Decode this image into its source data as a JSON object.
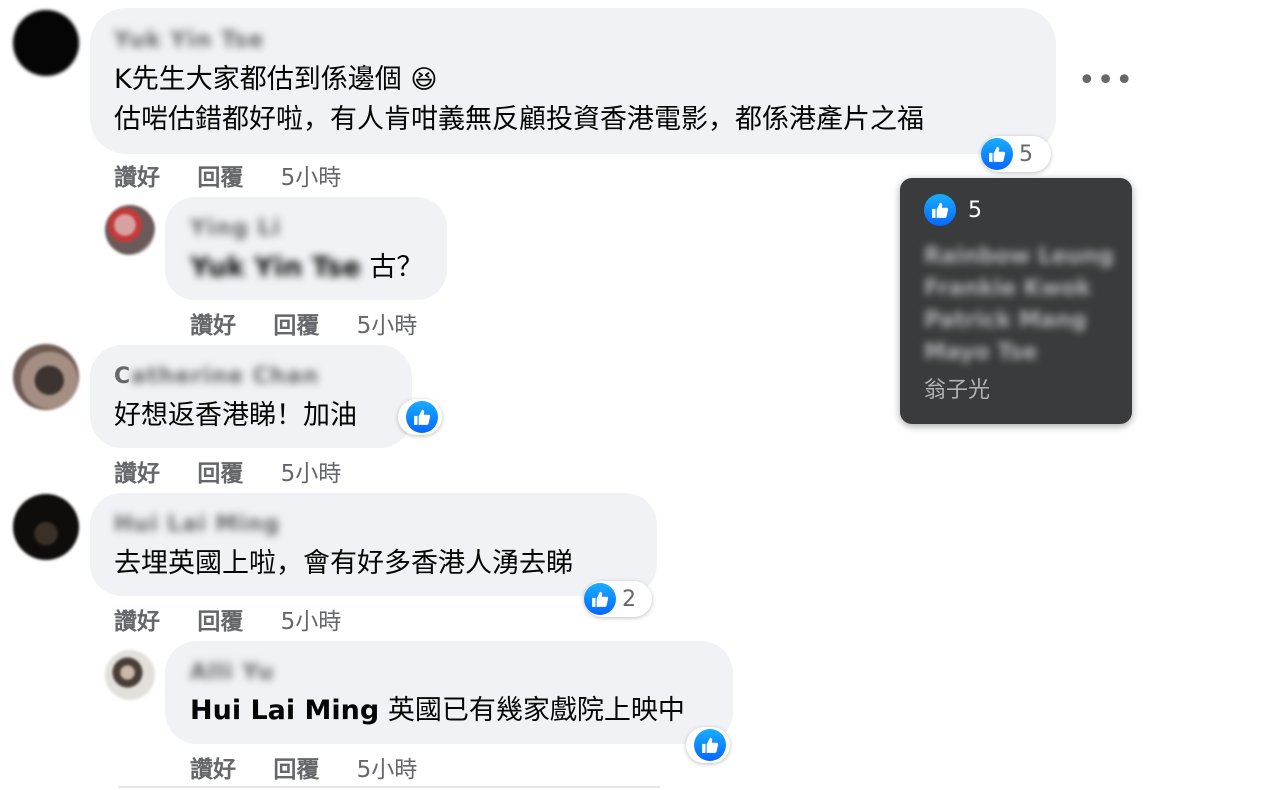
{
  "comments": [
    {
      "author": "Yuk Yin Tse",
      "lines": [
        "K先生大家都估到係邊個",
        "估啱估錯都好啦，有人肯咁義無反顧投資香港電影，都係港產片之福"
      ],
      "emoji": "😆",
      "reaction_count": "5",
      "like_label": "讚好",
      "reply_label": "回覆",
      "time": "5小時"
    },
    {
      "author": "Ying Li",
      "mention": "Yuk Yin Tse",
      "text": " 古？",
      "like_label": "讚好",
      "reply_label": "回覆",
      "time": "5小時"
    },
    {
      "author_first": "C",
      "author_rest": "atherine Chan",
      "text": "好想返香港睇！加油",
      "like_label": "讚好",
      "reply_label": "回覆",
      "time": "5小時"
    },
    {
      "author": "Hui Lai Ming",
      "text": "去埋英國上啦，會有好多香港人湧去睇",
      "reaction_count": "2",
      "like_label": "讚好",
      "reply_label": "回覆",
      "time": "5小時"
    },
    {
      "author": "Alli Yu",
      "mention": "Hui Lai Ming",
      "text": " 英國已有幾家戲院上映中",
      "like_label": "讚好",
      "reply_label": "回覆",
      "time": "5小時"
    }
  ],
  "more_label": "•••",
  "tooltip": {
    "count": "5",
    "names_blurred": [
      "Rainbow Leung",
      "Frankie Kwok",
      "Patrick Mang",
      "Mayo Tse"
    ],
    "names_visible": [
      "翁子光"
    ]
  },
  "colors": {
    "bubble": "#f0f2f5",
    "secondary_text": "#65676b",
    "like_blue": "#0866ff",
    "tooltip_bg": "#3a3b3c"
  }
}
